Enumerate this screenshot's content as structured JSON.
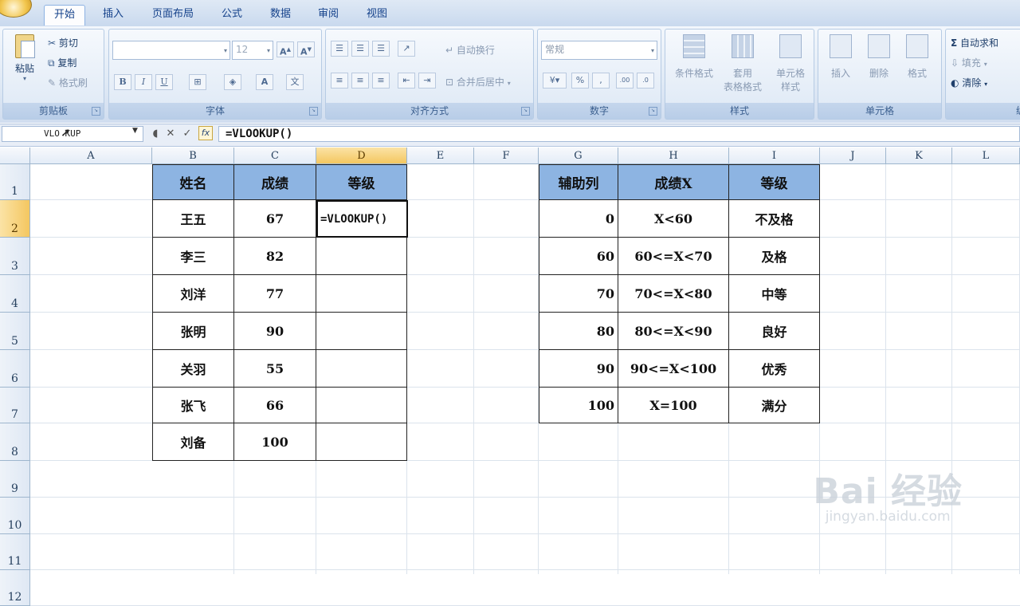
{
  "tabs": [
    "开始",
    "插入",
    "页面布局",
    "公式",
    "数据",
    "审阅",
    "视图"
  ],
  "clipboard": {
    "paste": "粘贴",
    "cut": "剪切",
    "copy": "复制",
    "format_painter": "格式刷",
    "label": "剪贴板"
  },
  "font": {
    "size": "12",
    "label": "字体"
  },
  "alignment": {
    "wrap": "自动换行",
    "merge": "合并后居中",
    "label": "对齐方式"
  },
  "number": {
    "format": "常规",
    "label": "数字"
  },
  "styles": {
    "conditional": "条件格式",
    "table_format_1": "套用",
    "table_format_2": "表格格式",
    "cell_styles_1": "单元格",
    "cell_styles_2": "样式",
    "label": "样式"
  },
  "cells": {
    "insert": "插入",
    "delete": "删除",
    "format": "格式",
    "label": "单元格"
  },
  "editing": {
    "autosum": "自动求和",
    "fill": "填充",
    "clear": "清除",
    "label_partial": "编"
  },
  "formula_bar": {
    "name_box": "VLO  KUP",
    "formula": "=VLOOKUP()"
  },
  "columns": [
    "A",
    "B",
    "C",
    "D",
    "E",
    "F",
    "G",
    "H",
    "I",
    "J",
    "K",
    "L"
  ],
  "rows": [
    "1",
    "2",
    "3",
    "4",
    "5",
    "6",
    "7",
    "8",
    "9",
    "10",
    "11",
    "12"
  ],
  "table1": {
    "headers": [
      "姓名",
      "成绩",
      "等级"
    ],
    "rows": [
      [
        "王五",
        "67",
        "=VLOOKUP()"
      ],
      [
        "李三",
        "82",
        ""
      ],
      [
        "刘洋",
        "77",
        ""
      ],
      [
        "张明",
        "90",
        ""
      ],
      [
        "关羽",
        "55",
        ""
      ],
      [
        "张飞",
        "66",
        ""
      ],
      [
        "刘备",
        "100",
        ""
      ]
    ]
  },
  "table2": {
    "headers": [
      "辅助列",
      "成绩X",
      "等级"
    ],
    "rows": [
      [
        "0",
        "X<60",
        "不及格"
      ],
      [
        "60",
        "60<=X<70",
        "及格"
      ],
      [
        "70",
        "70<=X<80",
        "中等"
      ],
      [
        "80",
        "80<=X<90",
        "良好"
      ],
      [
        "90",
        "90<=X<100",
        "优秀"
      ],
      [
        "100",
        "X=100",
        "满分"
      ]
    ]
  },
  "watermark": {
    "logo": "Bai 经验",
    "url": "jingyan.baidu.com"
  },
  "colors": {
    "header_fill": "#8db4e2",
    "selected_header": "#f4c760"
  }
}
